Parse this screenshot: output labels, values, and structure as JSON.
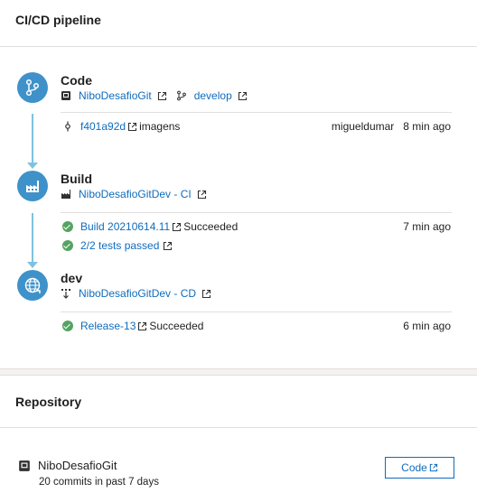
{
  "header": {
    "title": "CI/CD pipeline"
  },
  "stages": {
    "code": {
      "name": "Code",
      "repo_link": "NiboDesafioGit",
      "branch_link": "develop",
      "commit": {
        "hash": "f401a92d",
        "message": "imagens",
        "author": "migueldumar",
        "time": "8 min ago"
      }
    },
    "build": {
      "name": "Build",
      "definition_link": "NiboDesafioGitDev - CI",
      "run": {
        "label": "Build 20210614.11",
        "status": "Succeeded",
        "time": "7 min ago"
      },
      "tests": {
        "label": "2/2 tests passed"
      }
    },
    "release": {
      "name": "dev",
      "definition_link": "NiboDesafioGitDev - CD",
      "run": {
        "label": "Release-13",
        "status": "Succeeded",
        "time": "6 min ago"
      }
    }
  },
  "repository": {
    "title": "Repository",
    "name": "NiboDesafioGit",
    "commits_text": "20 commits in past 7 days",
    "code_button_label": "Code"
  },
  "colors": {
    "accent": "#0f6cbd",
    "stage_icon": "#3f92c9",
    "connector": "#7dc3e0",
    "success": "#55a362"
  },
  "icons": {
    "code_stage": "git-branch-icon",
    "build_stage": "build-factory-icon",
    "release_stage": "globe-deploy-icon",
    "external_link": "external-link-icon",
    "success": "check-circle-icon"
  }
}
